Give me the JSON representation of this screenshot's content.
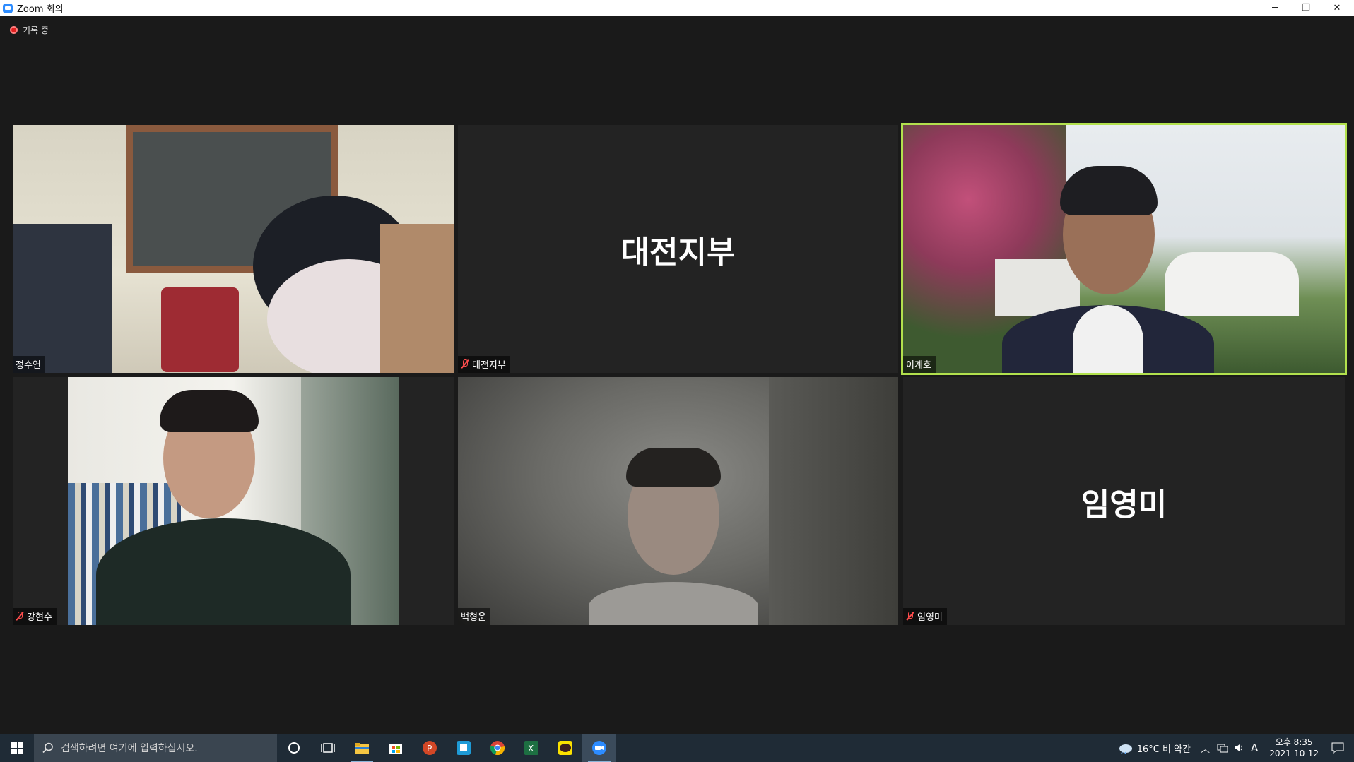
{
  "window": {
    "title": "Zoom 회의",
    "minimize": "─",
    "restore": "❐",
    "close": "✕"
  },
  "recording": {
    "label": "기록 중"
  },
  "participants": [
    {
      "name": "정수연",
      "muted": false,
      "video": true
    },
    {
      "name": "대전지부",
      "muted": true,
      "video": false,
      "display": "대전지부"
    },
    {
      "name": "이계호",
      "muted": false,
      "video": true,
      "speaking": true
    },
    {
      "name": "강현수",
      "muted": true,
      "video": true
    },
    {
      "name": "백형운",
      "muted": false,
      "video": true
    },
    {
      "name": "임영미",
      "muted": true,
      "video": false,
      "display": "임영미"
    }
  ],
  "taskbar": {
    "search_placeholder": "검색하려면 여기에 입력하십시오.",
    "weather": "16°C  비 약간",
    "ime": "A",
    "time": "오후 8:35",
    "date": "2021-10-12",
    "apps": [
      "cortana-icon",
      "task-view-icon",
      "file-explorer-icon",
      "store-icon",
      "powerpoint-icon",
      "hwp-icon",
      "chrome-icon",
      "excel-icon",
      "kakaotalk-icon",
      "zoom-icon"
    ]
  },
  "colors": {
    "active_speaker": "#b2e14d",
    "muted_icon": "#ff4d4d",
    "zoom_blue": "#2d8cff"
  }
}
